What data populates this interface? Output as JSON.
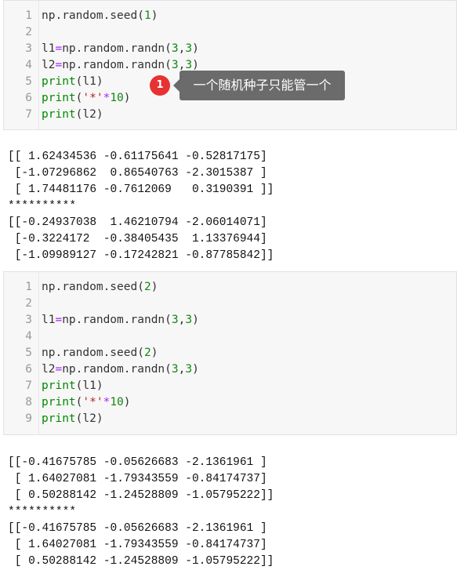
{
  "cell1": {
    "lines": [
      {
        "n": "1",
        "tokens": [
          [
            "plain",
            "np.random.seed("
          ],
          [
            "num",
            "1"
          ],
          [
            "plain",
            ")"
          ]
        ]
      },
      {
        "n": "2",
        "tokens": []
      },
      {
        "n": "3",
        "tokens": [
          [
            "plain",
            "l1"
          ],
          [
            "op",
            "="
          ],
          [
            "plain",
            "np.random.randn("
          ],
          [
            "num",
            "3"
          ],
          [
            "plain",
            ","
          ],
          [
            "num",
            "3"
          ],
          [
            "plain",
            ")"
          ]
        ]
      },
      {
        "n": "4",
        "tokens": [
          [
            "plain",
            "l2"
          ],
          [
            "op",
            "="
          ],
          [
            "plain",
            "np.random.randn("
          ],
          [
            "num",
            "3"
          ],
          [
            "plain",
            ","
          ],
          [
            "num",
            "3"
          ],
          [
            "plain",
            ")"
          ]
        ]
      },
      {
        "n": "5",
        "tokens": [
          [
            "kw",
            "print"
          ],
          [
            "plain",
            "(l1)"
          ]
        ]
      },
      {
        "n": "6",
        "tokens": [
          [
            "kw",
            "print"
          ],
          [
            "plain",
            "("
          ],
          [
            "str",
            "'*'"
          ],
          [
            "op",
            "*"
          ],
          [
            "num",
            "10"
          ],
          [
            "plain",
            ")"
          ]
        ]
      },
      {
        "n": "7",
        "tokens": [
          [
            "kw",
            "print"
          ],
          [
            "plain",
            "(l2)"
          ]
        ]
      }
    ]
  },
  "output1": "[[ 1.62434536 -0.61175641 -0.52817175]\n [-1.07296862  0.86540763 -2.3015387 ]\n [ 1.74481176 -0.7612069   0.3190391 ]]\n**********\n[[-0.24937038  1.46210794 -2.06014071]\n [-0.3224172  -0.38405435  1.13376944]\n [-1.09989127 -0.17242821 -0.87785842]]",
  "annotation": {
    "badge": "1",
    "tooltip": "一个随机种子只能管一个"
  },
  "cell2": {
    "lines": [
      {
        "n": "1",
        "tokens": [
          [
            "plain",
            "np.random.seed("
          ],
          [
            "num",
            "2"
          ],
          [
            "plain",
            ")"
          ]
        ]
      },
      {
        "n": "2",
        "tokens": []
      },
      {
        "n": "3",
        "tokens": [
          [
            "plain",
            "l1"
          ],
          [
            "op",
            "="
          ],
          [
            "plain",
            "np.random.randn("
          ],
          [
            "num",
            "3"
          ],
          [
            "plain",
            ","
          ],
          [
            "num",
            "3"
          ],
          [
            "plain",
            ")"
          ]
        ]
      },
      {
        "n": "4",
        "tokens": []
      },
      {
        "n": "5",
        "tokens": [
          [
            "plain",
            "np.random.seed("
          ],
          [
            "num",
            "2"
          ],
          [
            "plain",
            ")"
          ]
        ]
      },
      {
        "n": "6",
        "tokens": [
          [
            "plain",
            "l2"
          ],
          [
            "op",
            "="
          ],
          [
            "plain",
            "np.random.randn("
          ],
          [
            "num",
            "3"
          ],
          [
            "plain",
            ","
          ],
          [
            "num",
            "3"
          ],
          [
            "plain",
            ")"
          ]
        ]
      },
      {
        "n": "7",
        "tokens": [
          [
            "kw",
            "print"
          ],
          [
            "plain",
            "(l1)"
          ]
        ]
      },
      {
        "n": "8",
        "tokens": [
          [
            "kw",
            "print"
          ],
          [
            "plain",
            "("
          ],
          [
            "str",
            "'*'"
          ],
          [
            "op",
            "*"
          ],
          [
            "num",
            "10"
          ],
          [
            "plain",
            ")"
          ]
        ]
      },
      {
        "n": "9",
        "tokens": [
          [
            "kw",
            "print"
          ],
          [
            "plain",
            "(l2)"
          ]
        ]
      }
    ]
  },
  "output2": "[[-0.41675785 -0.05626683 -2.1361961 ]\n [ 1.64027081 -1.79343559 -0.84174737]\n [ 0.50288142 -1.24528809 -1.05795222]]\n**********\n[[-0.41675785 -0.05626683 -2.1361961 ]\n [ 1.64027081 -1.79343559 -0.84174737]\n [ 0.50288142 -1.24528809 -1.05795222]]"
}
